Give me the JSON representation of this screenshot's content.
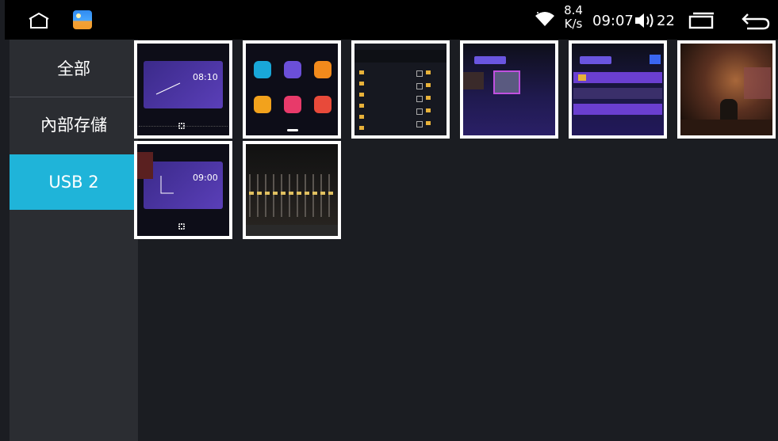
{
  "status_bar": {
    "net_speed_value": "8.4",
    "net_speed_unit": "K/s",
    "time": "09:07",
    "volume": "22",
    "icons": [
      "home-icon",
      "gallery-app-icon",
      "wifi-icon",
      "volume-icon",
      "recents-icon",
      "back-icon"
    ]
  },
  "sidebar": {
    "items": [
      {
        "label": "全部",
        "active": false
      },
      {
        "label": "內部存儲",
        "active": false
      },
      {
        "label": "USB 2",
        "active": true
      }
    ]
  },
  "colors": {
    "accent": "#1fb4d9",
    "sidebar_bg": "#2b2d32",
    "content_bg": "#1b1d22",
    "status_bar_bg": "#000000"
  },
  "thumbnails": [
    {
      "kind": "clock-widget-screenshot",
      "clock": "08:10"
    },
    {
      "kind": "app-launcher-screenshot"
    },
    {
      "kind": "file-manager-screenshot"
    },
    {
      "kind": "video-folder-screenshot"
    },
    {
      "kind": "folder-list-screenshot"
    },
    {
      "kind": "photo-piano-room"
    },
    {
      "kind": "clock-widget-screenshot",
      "clock": "09:00"
    },
    {
      "kind": "equalizer-screenshot"
    }
  ]
}
